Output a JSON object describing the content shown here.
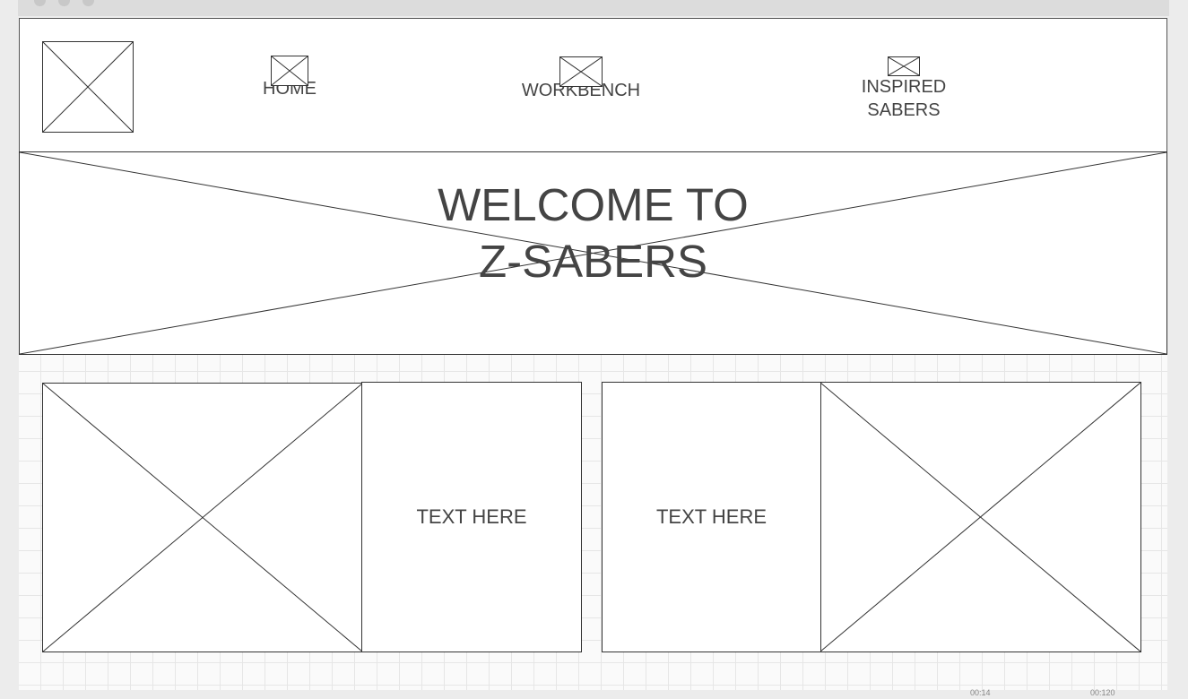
{
  "nav": {
    "items": [
      {
        "label": "HOME"
      },
      {
        "label": "WORKBENCH"
      },
      {
        "label": "INSPIRED\nSABERS"
      }
    ]
  },
  "hero": {
    "title": "WELCOME TO\nZ-SABERS"
  },
  "cards": [
    {
      "text": "TEXT HERE"
    },
    {
      "text": "TEXT HERE"
    }
  ],
  "status": {
    "left_value": "00:14",
    "right_value": "00:120"
  },
  "colors": {
    "stroke": "#333333",
    "text": "#444444",
    "grid": "#e6e6e6",
    "canvas": "#fafafa"
  }
}
